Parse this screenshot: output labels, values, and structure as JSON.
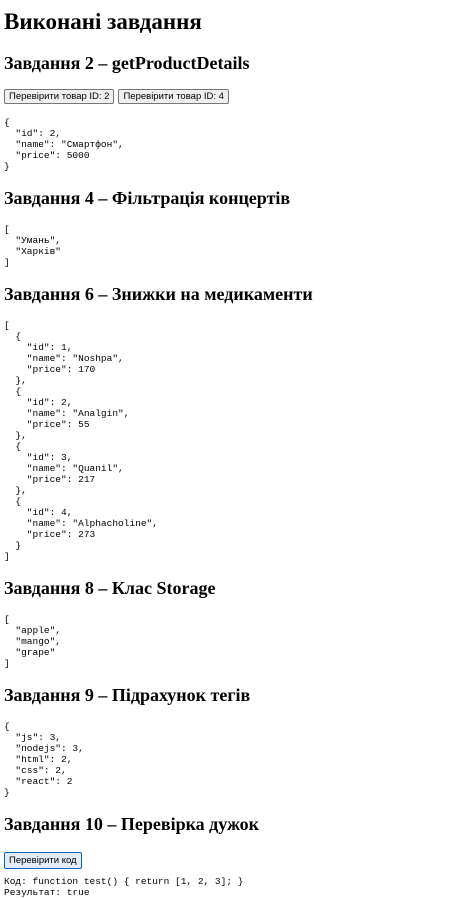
{
  "page": {
    "title": "Виконані завдання"
  },
  "task2": {
    "heading": "Завдання 2 – getProductDetails",
    "button1": "Перевірити товар ID: 2",
    "button2": "Перевірити товар ID: 4",
    "output": "{\n  \"id\": 2,\n  \"name\": \"Смартфон\",\n  \"price\": 5000\n}"
  },
  "task4": {
    "heading": "Завдання 4 – Фільтрація концертів",
    "output": "[\n  \"Умань\",\n  \"Харків\"\n]"
  },
  "task6": {
    "heading": "Завдання 6 – Знижки на медикаменти",
    "output": "[\n  {\n    \"id\": 1,\n    \"name\": \"Noshpa\",\n    \"price\": 170\n  },\n  {\n    \"id\": 2,\n    \"name\": \"Analgin\",\n    \"price\": 55\n  },\n  {\n    \"id\": 3,\n    \"name\": \"Quanil\",\n    \"price\": 217\n  },\n  {\n    \"id\": 4,\n    \"name\": \"Alphacholine\",\n    \"price\": 273\n  }\n]"
  },
  "task8": {
    "heading": "Завдання 8 – Клас Storage",
    "output": "[\n  \"apple\",\n  \"mango\",\n  \"grape\"\n]"
  },
  "task9": {
    "heading": "Завдання 9 – Підрахунок тегів",
    "output": "{\n  \"js\": 3,\n  \"nodejs\": 3,\n  \"html\": 2,\n  \"css\": 2,\n  \"react\": 2\n}"
  },
  "task10": {
    "heading": "Завдання 10 – Перевірка дужок",
    "button": "Перевірити код",
    "code_line": "Код: function test() { return [1, 2, 3]; }",
    "result_line": "Результат: true"
  }
}
